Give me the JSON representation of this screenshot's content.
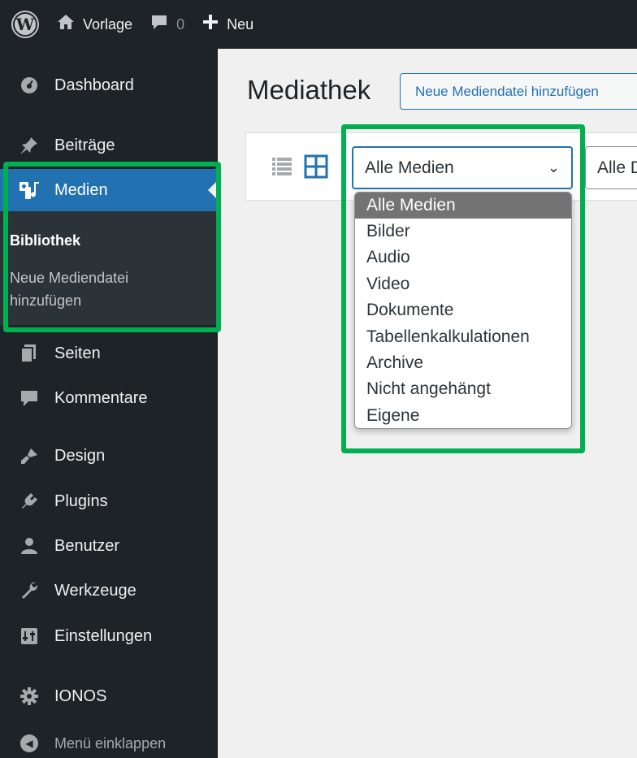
{
  "adminbar": {
    "site_name": "Vorlage",
    "comments_count": "0",
    "new_label": "Neu",
    "wp_logo_letter": "W"
  },
  "sidebar": {
    "items": [
      {
        "label": "Dashboard",
        "icon": "dashboard-icon"
      },
      {
        "label": "Beiträge",
        "icon": "pin-icon"
      },
      {
        "label": "Medien",
        "icon": "media-icon"
      },
      {
        "label": "Seiten",
        "icon": "pages-icon"
      },
      {
        "label": "Kommentare",
        "icon": "comment-icon"
      },
      {
        "label": "Design",
        "icon": "brush-icon"
      },
      {
        "label": "Plugins",
        "icon": "plugin-icon"
      },
      {
        "label": "Benutzer",
        "icon": "user-icon"
      },
      {
        "label": "Werkzeuge",
        "icon": "wrench-icon"
      },
      {
        "label": "Einstellungen",
        "icon": "settings-icon"
      },
      {
        "label": "IONOS",
        "icon": "gear-icon"
      }
    ],
    "submenu": {
      "library": "Bibliothek",
      "add_new_line1": "Neue Mediendatei",
      "add_new_line2": "hinzufügen"
    },
    "collapse_label": "Menü einklappen"
  },
  "main": {
    "title": "Mediathek",
    "add_new_button": "Neue Mediendatei hinzufügen",
    "filter_select": "Alle Medien",
    "date_select": "Alle Daten",
    "filter_options": [
      "Alle Medien",
      "Bilder",
      "Audio",
      "Video",
      "Dokumente",
      "Tabellenkalkulationen",
      "Archive",
      "Nicht angehängt",
      "Eigene"
    ]
  },
  "colors": {
    "highlight": "#00b050",
    "accent": "#2271b1",
    "sidebar_bg": "#1d2327"
  }
}
